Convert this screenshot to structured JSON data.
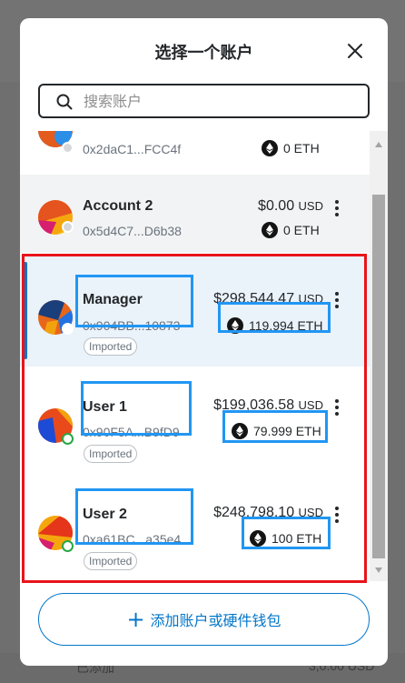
{
  "modal": {
    "title": "选择一个账户",
    "search_placeholder": "搜索账户",
    "add_button_label": "添加账户或硬件钱包"
  },
  "background": {
    "left_text": "已添加",
    "right_text": "3,0.00 USD"
  },
  "accounts": [
    {
      "name": "",
      "address": "0x2daC1...FCC4f",
      "usd_value": "",
      "usd_unit": "",
      "eth": "0 ETH",
      "badge": ""
    },
    {
      "name": "Account 2",
      "address": "0x5d4C7...D6b38",
      "usd_value": "$0.00",
      "usd_unit": "USD",
      "eth": "0 ETH",
      "badge": ""
    },
    {
      "name": "Manager",
      "address": "0x904BB...10873",
      "usd_value": "$298,544.47",
      "usd_unit": "USD",
      "eth": "119.994 ETH",
      "badge": "Imported",
      "selected": true
    },
    {
      "name": "User 1",
      "address": "0x90F5A...B9fD9",
      "usd_value": "$199,036.58",
      "usd_unit": "USD",
      "eth": "79.999 ETH",
      "badge": "Imported"
    },
    {
      "name": "User 2",
      "address": "0xa61BC...a35e4",
      "usd_value": "$248,798.10",
      "usd_unit": "USD",
      "eth": "100 ETH",
      "badge": "Imported"
    }
  ],
  "colors": {
    "accent": "#0376c9",
    "highlight_red": "#e8141a",
    "highlight_blue": "#2196f3",
    "selected_row": "#eaf2fa"
  }
}
